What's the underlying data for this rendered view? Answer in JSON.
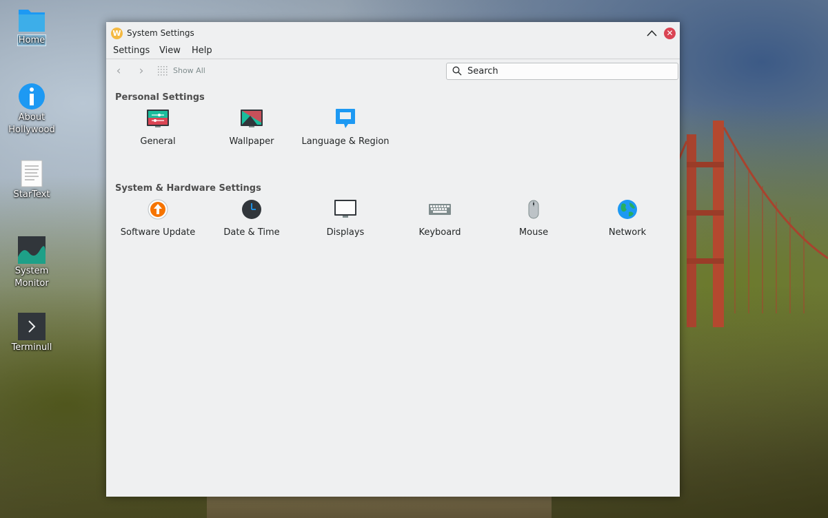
{
  "desktop": {
    "icons": [
      {
        "label": "Home"
      },
      {
        "label": "About Hollywood"
      },
      {
        "label": "StarText"
      },
      {
        "label": "System Monitor"
      },
      {
        "label": "Terminull"
      }
    ]
  },
  "window": {
    "title": "System Settings",
    "menus": [
      {
        "label": "Settings"
      },
      {
        "label": "View"
      },
      {
        "label": "Help"
      }
    ],
    "toolbar": {
      "show_all_label": "Show All",
      "search_placeholder": "Search"
    },
    "sections": [
      {
        "title": "Personal Settings",
        "items": [
          {
            "label": "General",
            "icon": "general-settings-icon"
          },
          {
            "label": "Wallpaper",
            "icon": "wallpaper-icon"
          },
          {
            "label": "Language & Region",
            "icon": "language-region-icon"
          }
        ]
      },
      {
        "title": "System & Hardware Settings",
        "items": [
          {
            "label": "Software Update",
            "icon": "software-update-icon"
          },
          {
            "label": "Date & Time",
            "icon": "clock-icon"
          },
          {
            "label": "Displays",
            "icon": "monitor-icon"
          },
          {
            "label": "Keyboard",
            "icon": "keyboard-icon"
          },
          {
            "label": "Mouse",
            "icon": "mouse-icon"
          },
          {
            "label": "Network",
            "icon": "globe-icon"
          }
        ]
      }
    ]
  },
  "colors": {
    "accent": "#3daee9",
    "close": "#da4453",
    "window_bg": "#eff0f1"
  }
}
